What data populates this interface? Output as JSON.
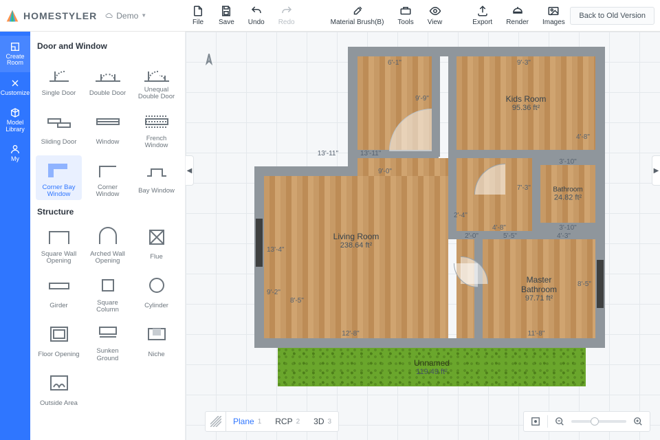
{
  "brand": {
    "name": "HOMESTYLER",
    "project_label": "Demo"
  },
  "toolbar": {
    "file": "File",
    "save": "Save",
    "undo": "Undo",
    "redo": "Redo",
    "material": "Material Brush(B)",
    "tools": "Tools",
    "view": "View",
    "export": "Export",
    "render": "Render",
    "images": "Images",
    "back": "Back to Old Version"
  },
  "rail": {
    "create_room": "Create\nRoom",
    "customize": "Customize",
    "model_library": "Model\nLibrary",
    "my": "My"
  },
  "catalog": {
    "section_doors": "Door and Window",
    "items_doors": [
      "Single Door",
      "Double Door",
      "Unequal Double Door",
      "Sliding Door",
      "Window",
      "French Window",
      "Corner Bay Window",
      "Corner Window",
      "Bay Window"
    ],
    "section_structure": "Structure",
    "items_structure": [
      "Square Wall Opening",
      "Arched Wall Opening",
      "Flue",
      "Girder",
      "Square Column",
      "Cylinder",
      "Floor Opening",
      "Sunken Ground",
      "Niche",
      "Outside Area"
    ],
    "selected": "Corner Bay Window"
  },
  "rooms": {
    "living": {
      "name": "Living Room",
      "area": "238.64 ft²"
    },
    "kids": {
      "name": "Kids Room",
      "area": "95.36 ft²"
    },
    "bath": {
      "name": "Bathroom",
      "area": "24.82 ft²"
    },
    "master": {
      "name": "Master Bathroom",
      "area": "97.71 ft²"
    },
    "unnamed": {
      "name": "Unnamed",
      "area": "119.49 ft²"
    }
  },
  "dims": {
    "top_left_room_w": "6'-1\"",
    "top_right_room_w": "9'-3\"",
    "top_left_room_h": "9'-9\"",
    "hall_split_l": "13'-11\"",
    "hall_split_r": "13'-11\"",
    "notch_w": "9'-0\"",
    "kids_right_h": "4'-8\"",
    "kids_to_bath": "7'-3\"",
    "bath_top": "3'-10\"",
    "bath_bottom": "3'-10\"",
    "living_h": "13'-4\"",
    "living_sub_h": "9'-2\"",
    "living_door": "8'-5\"",
    "living_to_hall": "2'-4\"",
    "hall_narrow": "2'-0\"",
    "hall_under_kids": "4'-8\"",
    "master_left_w": "5'-5\"",
    "master_right_w": "4'-3\"",
    "master_h": "8'-5\"",
    "bottom_left": "12'-8\"",
    "bottom_right": "11'-8\""
  },
  "viewbar": {
    "plane": "Plane",
    "plane_key": "1",
    "rcp": "RCP",
    "rcp_key": "2",
    "threeD": "3D",
    "threeD_key": "3"
  }
}
